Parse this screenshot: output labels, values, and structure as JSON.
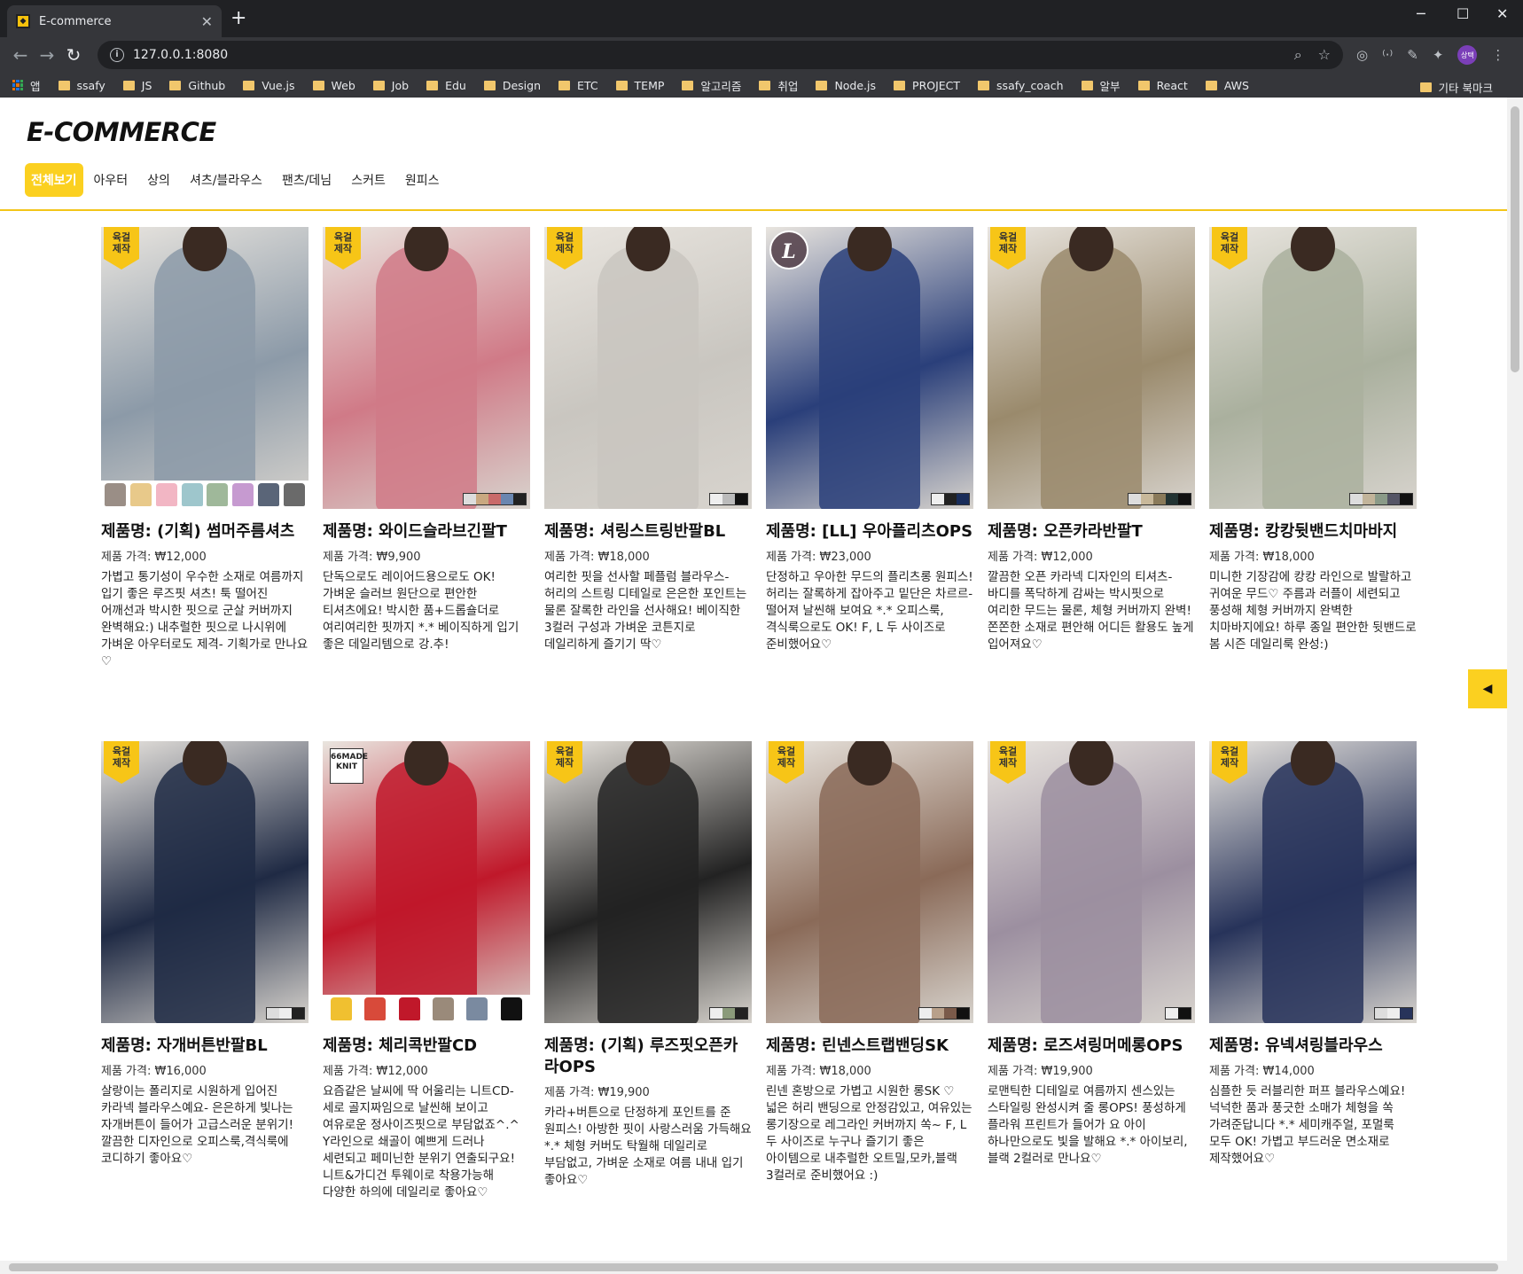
{
  "browser": {
    "tab_title": "E-commerce",
    "url": "127.0.0.1:8080",
    "bookmarks": [
      "앱",
      "ssafy",
      "JS",
      "Github",
      "Vue.js",
      "Web",
      "Job",
      "Edu",
      "Design",
      "ETC",
      "TEMP",
      "알고리즘",
      "취업",
      "Node.js",
      "PROJECT",
      "ssafy_coach",
      "알부",
      "React",
      "AWS"
    ],
    "other_bookmarks": "기타 북마크",
    "profile_label": "상택"
  },
  "site": {
    "logo": "E-COMMERCE",
    "categories": [
      "전체보기",
      "아우터",
      "상의",
      "셔츠/블라우스",
      "팬츠/데님",
      "스커트",
      "원피스"
    ]
  },
  "products": [
    {
      "title": "제품명: (기획) 썸머주름셔츠",
      "price": "제품 가격: ₩12,000",
      "desc": "가볍고 통기성이 우수한 소재로 여름까지 입기 좋은 루즈핏 셔츠! 툭 떨어진 어깨선과 박시한 핏으로 군살 커버까지 완벽해요:) 내추럴한 핏으로 나시위에 가벼운 아우터로도 제격- 기획가로 만나요♡",
      "badge_text": "육걸\n제작",
      "image_color": "#8c9aa8"
    },
    {
      "title": "제품명: 와이드슬라브긴팔T",
      "price": "제품 가격: ₩9,900",
      "desc": "단독으로도 레이어드용으로도 OK! 가벼운 슬러브 원단으로 편안한 티셔츠에요! 박시한 품+드롭숄더로 여리여리한 핏까지 *.* 베이직하게 입기 좋은 데일리템으로 강.추!",
      "badge_text": "육걸\n제작",
      "image_color": "#d07a87"
    },
    {
      "title": "제품명: 셔링스트링반팔BL",
      "price": "제품 가격: ₩18,000",
      "desc": "여리한 핏을 선사할 페플럼 블라우스- 허리의 스트링 디테일로 은은한 포인트는 물론 잘록한 라인을 선사해요! 베이직한 3컬러 구성과 가벼운 코튼지로 데일리하게 즐기기 딱♡",
      "badge_text": "육걸\n제작",
      "image_color": "#c9c6c0"
    },
    {
      "title": "제품명: [LL] 우아플리츠OPS",
      "price": "제품 가격: ₩23,000",
      "desc": "단정하고 우아한 무드의 플리츠롱 원피스! 허리는 잘록하게 잡아주고 밑단은 차르르- 떨어져 날씬해 보여요 *.* 오피스룩, 격식룩으로도 OK! F, L 두 사이즈로 준비했어요♡",
      "badge_text": "L",
      "image_color": "#2a3f7a"
    },
    {
      "title": "제품명: 오픈카라반팔T",
      "price": "제품 가격: ₩12,000",
      "desc": "깔끔한 오픈 카라넥 디자인의 티셔츠- 바디를 폭닥하게 감싸는 박시핏으로 여리한 무드는 물론, 체형 커버까지 완벽! 쫀쫀한 소재로 편안해 어디든 활용도 높게 입어져요♡",
      "badge_text": "육걸\n제작",
      "image_color": "#9a8a6c"
    },
    {
      "title": "제품명: 캉캉뒷밴드치마바지",
      "price": "제품 가격: ₩18,000",
      "desc": "미니한 기장감에 캉캉 라인으로 발랄하고 귀여운 무드♡ 주름과 러플이 세련되고 풍성해 체형 커버까지 완벽한 치마바지에요! 하루 종일 편안한 뒷밴드로 봄 시즌 데일리룩 완성:)",
      "badge_text": "육걸\n제작",
      "image_color": "#aab09e"
    },
    {
      "title": "제품명: 자개버튼반팔BL",
      "price": "제품 가격: ₩16,000",
      "desc": "살랑이는 폴리지로 시원하게 입어진 카라넥 블라우스예요- 은은하게 빛나는 자개버튼이 들어가 고급스러운 분위기! 깔끔한 디자인으로 오피스룩,격식룩에 코디하기 좋아요♡",
      "badge_text": "육걸\n제작",
      "image_color": "#1f2a44"
    },
    {
      "title": "제품명: 체리콕반팔CD",
      "price": "제품 가격: ₩12,000",
      "desc": "요즘같은 날씨에 딱 어울리는 니트CD- 세로 골지짜임으로 날씬해 보이고 여유로운 정사이즈핏으로 부담없죠^.^ Y라인으로 쇄골이 예쁘게 드러나 세련되고 페미닌한 분위기 연출되구요! 니트&가디건 투웨이로 착용가능해 다양한 하의에 데일리로 좋아요♡",
      "badge_text": "66MADE KNIT",
      "image_color": "#c0182a"
    },
    {
      "title": "제품명: (기획) 루즈핏오픈카라OPS",
      "price": "제품 가격: ₩19,900",
      "desc": "카라+버튼으로 단정하게 포인트를 준 원피스! 아방한 핏이 사랑스러움 가득해요 *.* 체형 커버도 탁월해 데일리로 부담없고, 가벼운 소재로 여름 내내 입기 좋아요♡",
      "badge_text": "육걸\n제작",
      "image_color": "#222222"
    },
    {
      "title": "제품명: 린넨스트랩밴딩SK",
      "price": "제품 가격: ₩18,000",
      "desc": "린넨 혼방으로 가볍고 시원한 롱SK ♡ 넓은 허리 밴딩으로 안정감있고, 여유있는 롱기장으로 레그라인 커버까지 쏙~ F, L 두 사이즈로 누구나 즐기기 좋은 아이템으로 내추럴한 오트밀,모카,블랙 3컬러로 준비했어요 :)",
      "badge_text": "육걸\n제작",
      "image_color": "#8a6a58"
    },
    {
      "title": "제품명: 로즈셔링머메롱OPS",
      "price": "제품 가격: ₩19,900",
      "desc": "로맨틱한 디테일로 여름까지 센스있는 스타일링 완성시켜 줄 롱OPS! 풍성하게 플라워 프린트가 들어가 요 아이 하나만으로도 빛을 발해요 *.* 아이보리, 블랙 2컬러로 만나요♡",
      "badge_text": "육걸\n제작",
      "image_color": "#9c8fa0"
    },
    {
      "title": "제품명: 유넥셔링블라우스",
      "price": "제품 가격: ₩14,000",
      "desc": "심플한 듯 러블리한 퍼프 블라우스예요! 넉넉한 품과 풍긋한 소매가 체형을 쏙 가려준답니다 *.* 세미캐주얼, 포멀룩 모두 OK! 가볍고 부드러운 면소재로 제작했어요♡",
      "badge_text": "육걸\n제작",
      "image_color": "#27335a"
    }
  ],
  "side_button_icon": "caret-left-icon"
}
